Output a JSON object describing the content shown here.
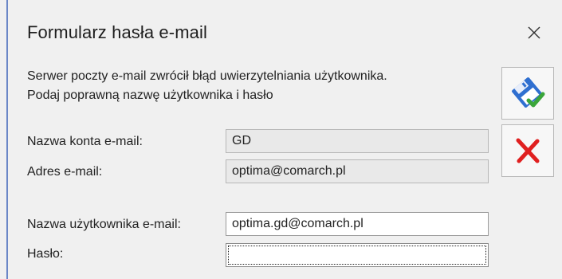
{
  "dialog": {
    "title": "Formularz hasła e-mail",
    "close_symbol": "✕"
  },
  "message": {
    "line1": "Serwer poczty e-mail zwrócił błąd uwierzytelniania użytkownika.",
    "line2": "Podaj poprawną nazwę użytkownika i hasło"
  },
  "fields": {
    "account_name": {
      "label": "Nazwa konta e-mail:",
      "value": "GD"
    },
    "email_address": {
      "label": "Adres e-mail:",
      "value": "optima@comarch.pl"
    },
    "username": {
      "label": "Nazwa użytkownika e-mail:",
      "value": "optima.gd@comarch.pl"
    },
    "password": {
      "label": "Hasło:",
      "value": ""
    }
  },
  "buttons": {
    "save": {
      "icon": "save-confirm-icon"
    },
    "cancel": {
      "icon": "cancel-x-icon"
    }
  },
  "colors": {
    "accent_border": "#6b87c7",
    "cancel_red": "#e02020",
    "save_blue": "#2f6fd0",
    "check_green": "#3aa53a"
  }
}
